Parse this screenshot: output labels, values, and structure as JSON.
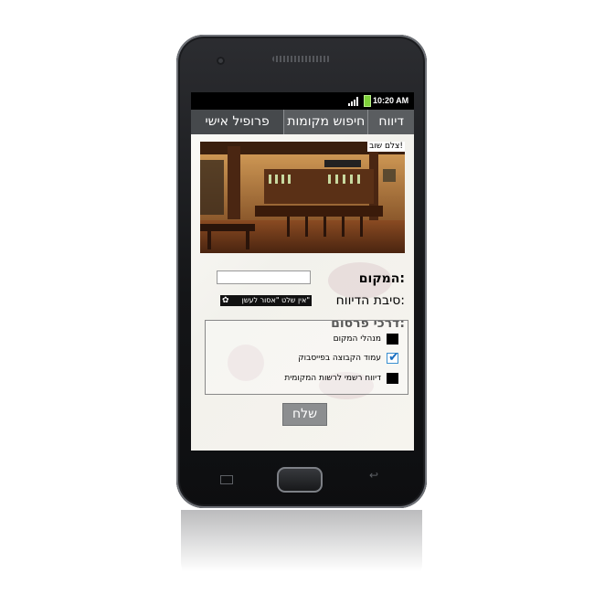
{
  "status_bar": {
    "time": "10:20 AM"
  },
  "tabs": [
    {
      "label": "דיווח"
    },
    {
      "label": "חיפוש מקומות"
    },
    {
      "label": "פרופיל אישי"
    }
  ],
  "photo": {
    "retake_label": "צלם שוב!"
  },
  "form": {
    "place_label": "המקום:",
    "place_value": "",
    "reason_label": "סיבת הדיווח:",
    "reason_value": "אין שלט \"אסור לעשן\"",
    "publish_label": "דרכי פרסום:",
    "options": [
      {
        "label": "מנהלי המקום",
        "checked": false
      },
      {
        "label": "עמוד הקבוצה בפייסבוק",
        "checked": true
      },
      {
        "label": "דיווח רשמי לרשות המקומית",
        "checked": false
      }
    ],
    "send_label": "שלח"
  },
  "colors": {
    "tab_bg": "#5a5d60",
    "battery": "#7fd13a",
    "check": "#1b6fc0"
  }
}
